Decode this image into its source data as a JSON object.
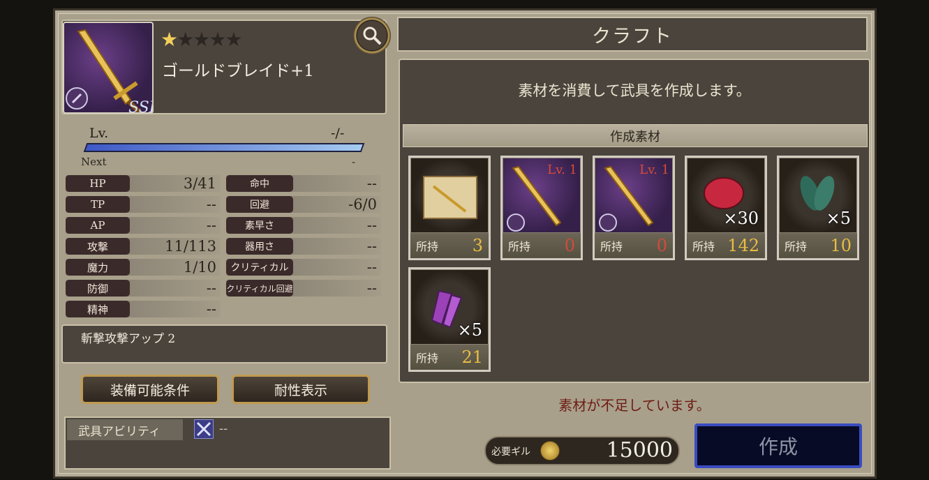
{
  "item": {
    "name": "ゴールドブレイド+1",
    "rarity_stars": 1,
    "rarity_max": 5,
    "rarity_badge": "SSR"
  },
  "level": {
    "label": "Lv.",
    "value": "-/-",
    "next_label": "Next",
    "next_value": "-"
  },
  "stats_left": [
    {
      "label": "HP",
      "value": "3/41"
    },
    {
      "label": "TP",
      "value": "--"
    },
    {
      "label": "AP",
      "value": "--"
    },
    {
      "label": "攻撃",
      "value": "11/113"
    },
    {
      "label": "魔力",
      "value": "1/10"
    },
    {
      "label": "防御",
      "value": "--"
    },
    {
      "label": "精神",
      "value": "--"
    }
  ],
  "stats_right": [
    {
      "label": "命中",
      "value": "--"
    },
    {
      "label": "回避",
      "value": "-6/0"
    },
    {
      "label": "素早さ",
      "value": "--"
    },
    {
      "label": "器用さ",
      "value": "--"
    },
    {
      "label": "クリティカル",
      "value": "--"
    },
    {
      "label": "クリティカル回避",
      "value": "--"
    }
  ],
  "skill": "斬撃攻撃アップ 2",
  "buttons": {
    "equip_conditions": "装備可能条件",
    "resistance": "耐性表示"
  },
  "ability": {
    "tab_label": "武具アビリティ",
    "value": "--"
  },
  "craft": {
    "title": "クラフト",
    "description": "素材を消費して武具を作成します。",
    "materials_header": "作成素材",
    "have_label": "所持",
    "materials": [
      {
        "icon": "scroll-icon",
        "have": "3"
      },
      {
        "icon": "gold-sword-icon",
        "lv": "Lv. 1",
        "have": "0"
      },
      {
        "icon": "gold-sword-icon",
        "lv": "Lv. 1",
        "have": "0"
      },
      {
        "icon": "red-gem-icon",
        "qty": "×30",
        "have": "142"
      },
      {
        "icon": "green-feather-icon",
        "qty": "×5",
        "have": "10"
      },
      {
        "icon": "purple-crystal-icon",
        "qty": "×5",
        "have": "21"
      }
    ],
    "shortage_message": "素材が不足しています。",
    "gil_label": "必要ギル",
    "gil_value": "15000",
    "create_label": "作成"
  }
}
